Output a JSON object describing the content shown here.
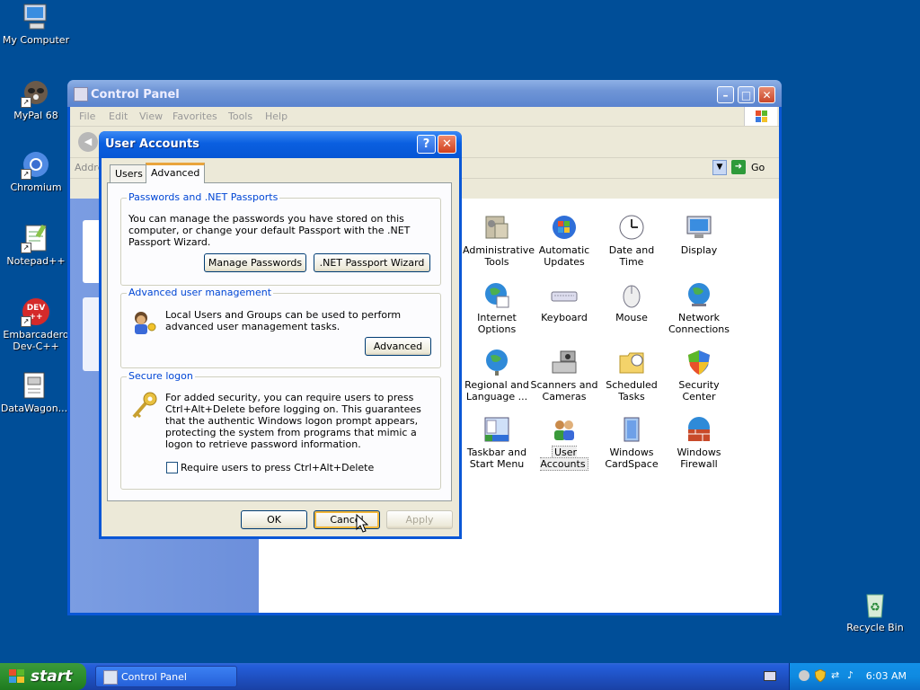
{
  "desktop": {
    "icons": [
      {
        "label": "My Computer"
      },
      {
        "label": "MyPal 68"
      },
      {
        "label": "Chromium"
      },
      {
        "label": "Notepad++"
      },
      {
        "label": "Embarcadero Dev-C++"
      },
      {
        "label": "DataWagon..."
      },
      {
        "label": "Recycle Bin"
      }
    ]
  },
  "control_panel": {
    "title": "Control Panel",
    "menu": [
      "File",
      "Edit",
      "View",
      "Favorites",
      "Tools",
      "Help"
    ],
    "address_label": "Addre",
    "go_label": "Go",
    "items": [
      {
        "label": "Administrative Tools",
        "icon": "admin-tools-icon"
      },
      {
        "label": "Automatic Updates",
        "icon": "windows-update-icon"
      },
      {
        "label": "Date and Time",
        "icon": "clock-icon"
      },
      {
        "label": "Display",
        "icon": "display-icon"
      },
      {
        "label": "Internet Options",
        "icon": "globe-icon"
      },
      {
        "label": "Keyboard",
        "icon": "keyboard-icon"
      },
      {
        "label": "Mouse",
        "icon": "mouse-icon"
      },
      {
        "label": "Network Connections",
        "icon": "network-globe-icon"
      },
      {
        "label": "Regional and Language ...",
        "icon": "regional-globe-icon"
      },
      {
        "label": "Scanners and Cameras",
        "icon": "scanner-icon"
      },
      {
        "label": "Scheduled Tasks",
        "icon": "folder-clock-icon"
      },
      {
        "label": "Security Center",
        "icon": "shield-icon"
      },
      {
        "label": "Taskbar and Start Menu",
        "icon": "taskbar-icon"
      },
      {
        "label": "User Accounts",
        "icon": "users-icon"
      },
      {
        "label": "Windows CardSpace",
        "icon": "cardspace-icon"
      },
      {
        "label": "Windows Firewall",
        "icon": "firewall-icon"
      }
    ]
  },
  "dialog": {
    "title": "User Accounts",
    "help_label": "?",
    "close_label": "✕",
    "tabs": [
      {
        "label": "Users"
      },
      {
        "label": "Advanced"
      }
    ],
    "passwords": {
      "title": "Passwords and .NET Passports",
      "text": "You can manage the passwords you have stored on this computer, or change your default Passport with the .NET Passport Wizard.",
      "manage_button": "Manage Passwords",
      "wizard_button": ".NET Passport Wizard"
    },
    "advanced_mgmt": {
      "title": "Advanced user management",
      "text": "Local Users and Groups can be used to perform advanced user management tasks.",
      "button": "Advanced"
    },
    "secure_logon": {
      "title": "Secure logon",
      "text": "For added security, you can require users to press Ctrl+Alt+Delete before logging on. This guarantees that the authentic Windows logon prompt appears, protecting the system from programs that mimic a logon to retrieve password information.",
      "checkbox_label": "Require users to press Ctrl+Alt+Delete",
      "checked": false
    },
    "ok_button": "OK",
    "cancel_button": "Cancel",
    "apply_button": "Apply"
  },
  "taskbar": {
    "start_label": "start",
    "task_label": "Control Panel",
    "clock": "6:03 AM"
  },
  "colors": {
    "desktop": "#004e98",
    "title_active": "#0a5fe0",
    "title_inactive": "#7a9bd8",
    "group_title": "#0046d5",
    "start_green": "#2d8e2d"
  }
}
